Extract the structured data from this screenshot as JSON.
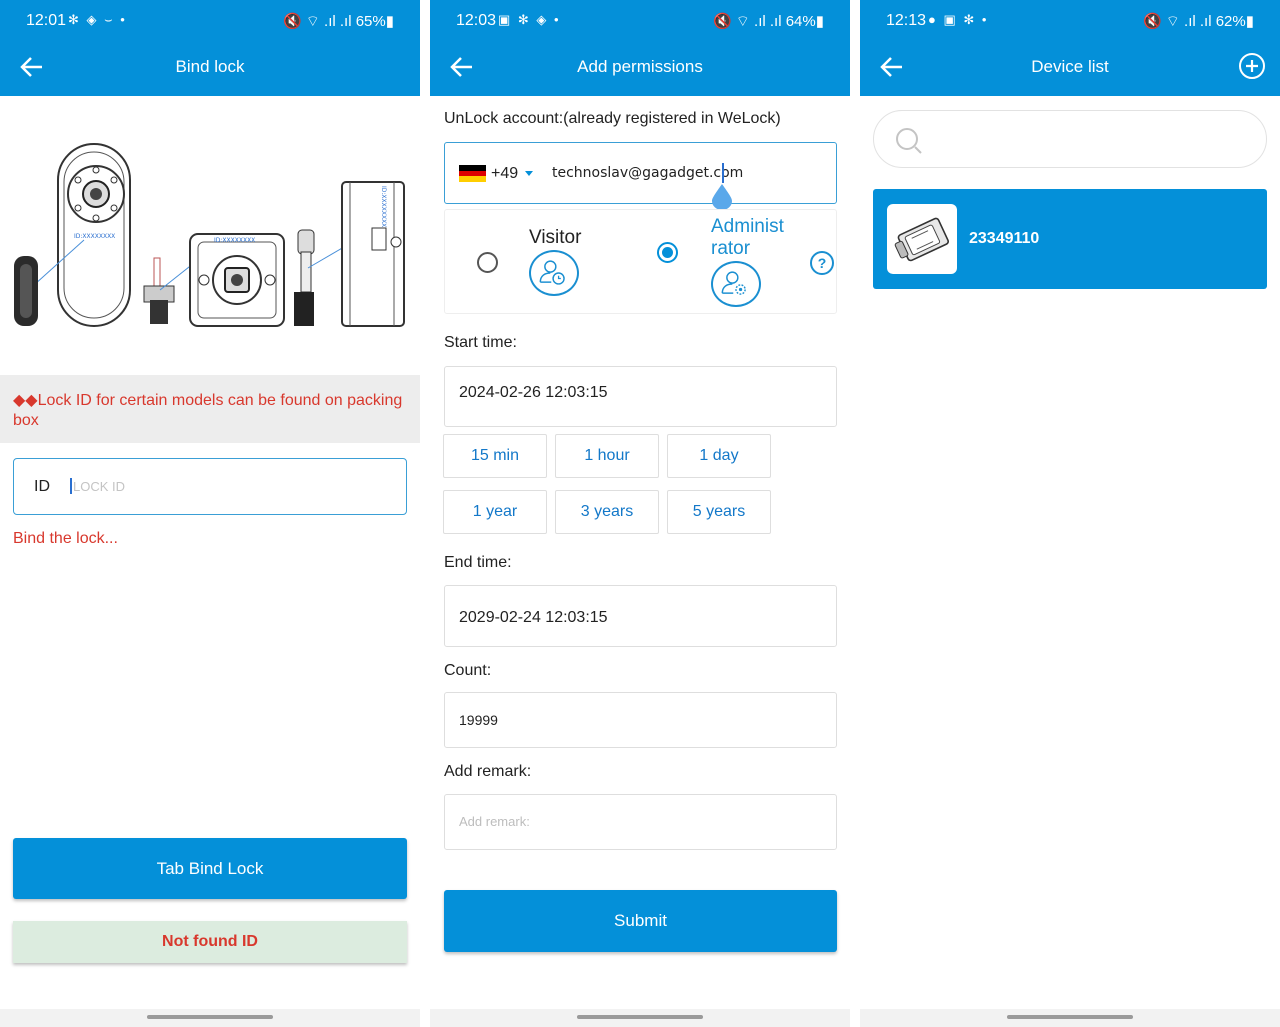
{
  "screen1": {
    "status": {
      "time": "12:01",
      "left_icons": "✻ ◈ ⌣ •",
      "right": "🔇 ⌔ .ıl .ıl 65%▮"
    },
    "appbar_title": "Bind lock",
    "illustration_labels": {
      "lock1": "ID:XXXXXXXX",
      "lock2": "ID:XXXXXXXX",
      "lock3": "ID:XXXXXXXX"
    },
    "notice": "◆◆Lock ID for certain models can be found on packing box",
    "id_label": "ID",
    "id_placeholder": "LOCK ID",
    "bind_status": "Bind the lock...",
    "tab_bind_button": "Tab Bind Lock",
    "not_found_button": "Not found ID"
  },
  "screen2": {
    "status": {
      "time": "12:03",
      "left_icons": "▣ ✻ ◈ •",
      "right": "🔇 ⌔ .ıl .ıl 64%▮"
    },
    "appbar_title": "Add permissions",
    "account_label": "UnLock account:(already registered in WeLock)",
    "country_code": "+49",
    "email": "technoslav@gagadget.com",
    "roles": {
      "visitor": "Visitor",
      "admin_line1": "Administ",
      "admin_line2": "rator",
      "selected": "Administrator"
    },
    "start_label": "Start time:",
    "start_value": "2024-02-26 12:03:15",
    "durations": [
      "15 min",
      "1 hour",
      "1 day",
      "1 year",
      "3 years",
      "5 years"
    ],
    "end_label": "End time:",
    "end_value": "2029-02-24 12:03:15",
    "count_label": "Count:",
    "count_value": "19999",
    "remark_label": "Add remark:",
    "remark_placeholder": "Add remark:",
    "submit": "Submit",
    "colors": {
      "accent": "#0490d9",
      "flag_black": "#000000",
      "flag_red": "#dd0000",
      "flag_gold": "#ffce00"
    }
  },
  "screen3": {
    "status": {
      "time": "12:13",
      "left_icons": "● ▣ ✻ •",
      "right": "🔇 ⌔ .ıl .ıl 62%▮"
    },
    "appbar_title": "Device list",
    "device_name": "23349110"
  }
}
